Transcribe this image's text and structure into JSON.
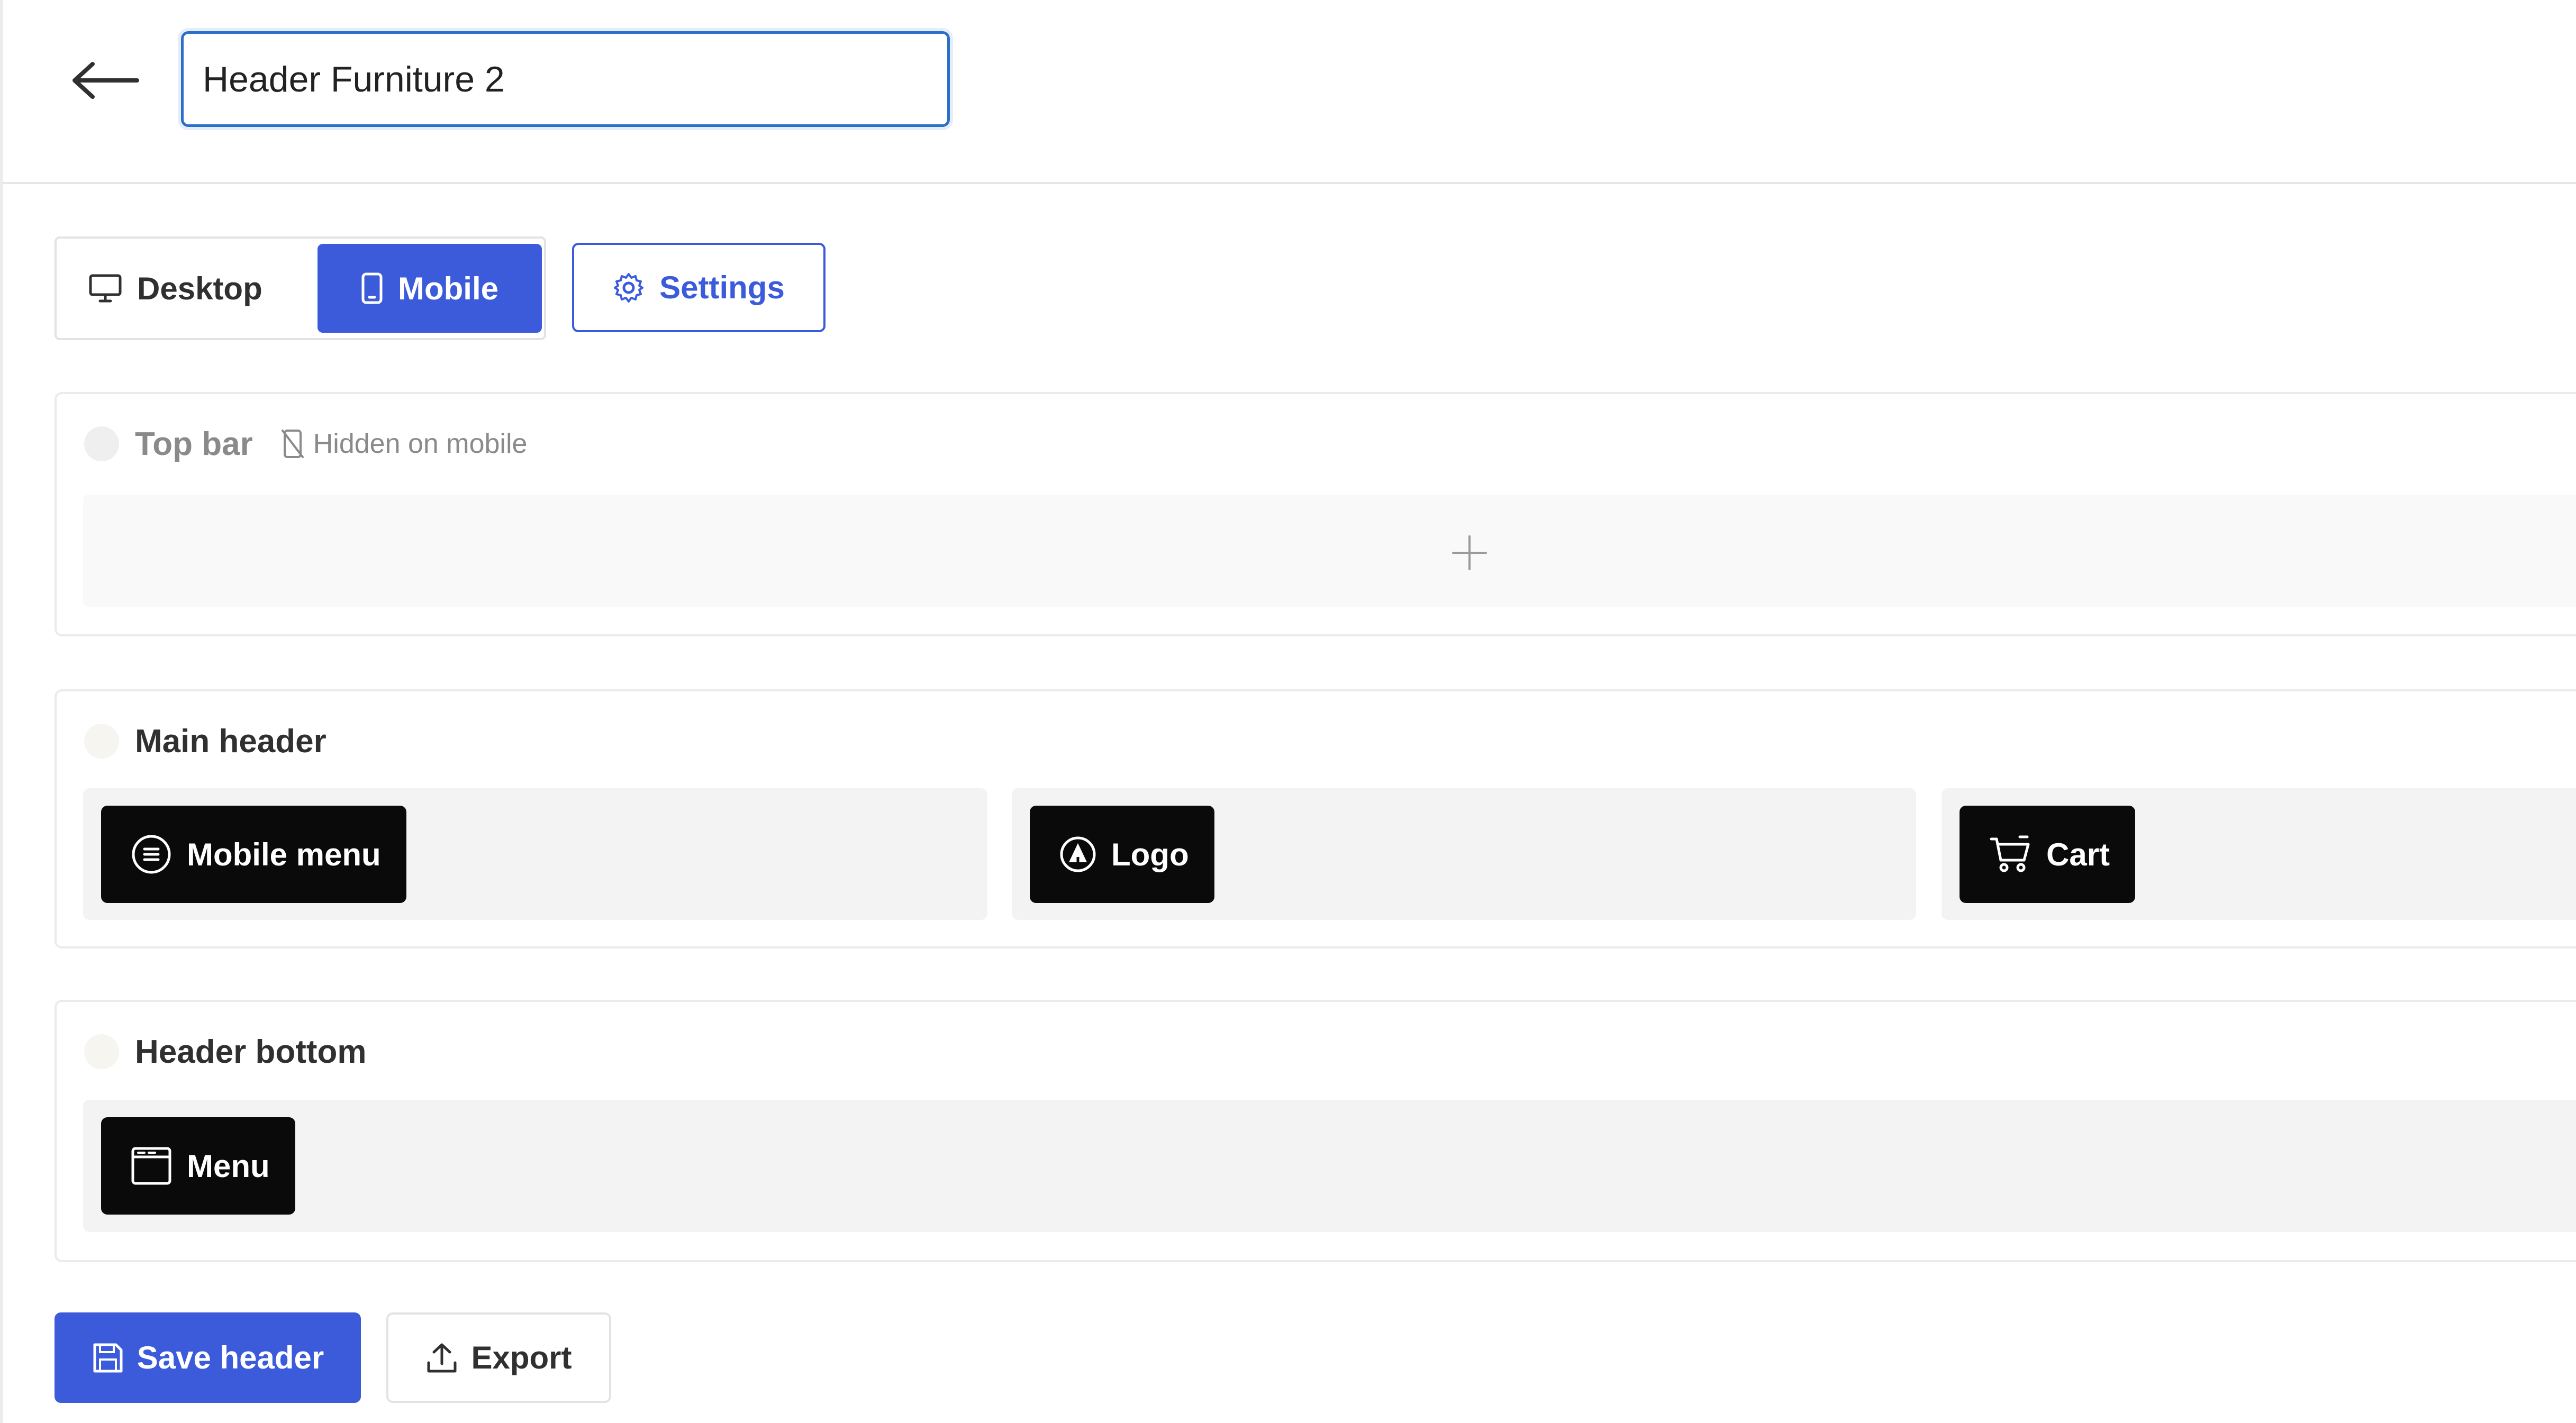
{
  "header": {
    "name_value": "Header Furniture 2",
    "back_icon": "arrow-left-icon"
  },
  "device_tabs": {
    "items": [
      {
        "label": "Desktop",
        "icon": "desktop-icon",
        "selected": false
      },
      {
        "label": "Mobile",
        "icon": "mobile-icon",
        "selected": true
      }
    ]
  },
  "settings": {
    "label": "Settings",
    "icon": "gear-icon"
  },
  "sections": {
    "top_bar": {
      "title": "Top bar",
      "note": "Hidden on mobile",
      "note_icon": "mobile-off-icon",
      "add_icon": "plus-icon"
    },
    "main_header": {
      "title": "Main header",
      "blocks": [
        {
          "label": "Mobile menu",
          "icon": "list-circle-icon"
        },
        {
          "label": "Logo",
          "icon": "logo-icon"
        },
        {
          "label": "Cart",
          "icon": "cart-icon"
        }
      ]
    },
    "header_bottom": {
      "title": "Header bottom",
      "blocks": [
        {
          "label": "Menu",
          "icon": "window-icon"
        }
      ]
    }
  },
  "footer": {
    "save_label": "Save header",
    "save_icon": "save-icon",
    "export_label": "Export",
    "export_icon": "upload-icon"
  },
  "colors": {
    "accent": "#3b5bdb",
    "block_bg": "#0a0a0a",
    "slot_bg": "#f3f3f3",
    "focus_border": "#2c6ecb"
  }
}
